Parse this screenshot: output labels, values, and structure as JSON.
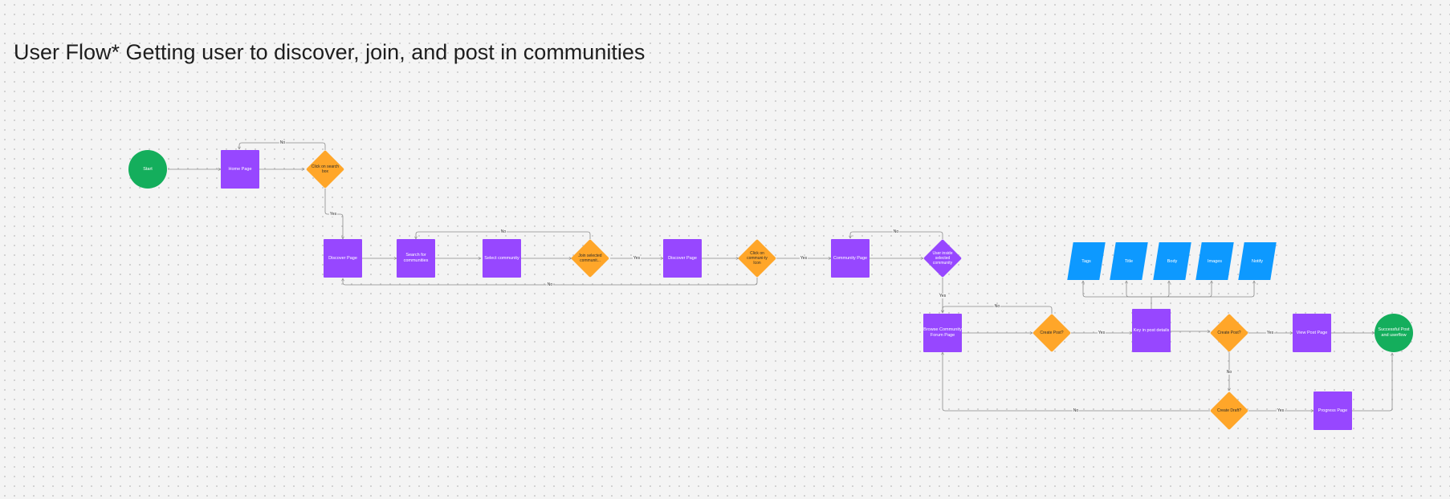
{
  "title": "User Flow* Getting user to discover, join, and post in communities",
  "colors": {
    "page_node": "#9747ff",
    "decision": "#ffa629",
    "terminal": "#14ae5c",
    "field": "#0d99ff",
    "connector": "#8a8a8a"
  },
  "nodes": {
    "start": "Start",
    "home_page": "Home Page",
    "click_search": "Click on search box",
    "discover_page_1": "Discover Page",
    "search_communities": "Search for communities",
    "select_community": "Select community",
    "join_community": "Join selected communit...",
    "discover_page_2": "Discover Page",
    "click_community_icon": "Click on communi-ty Icon",
    "community_page": "Community Page",
    "user_inside_community": "User inside selected community",
    "browse_forum": "Browse Community Forum Page",
    "create_post_q": "Create Post?",
    "key_in_post": "Key in post details",
    "create_post_q2": "Create Post?",
    "view_post": "View Post Page",
    "success": "Successful Post and userflow",
    "create_draft_q": "Create Draft?",
    "progress_page": "Progress Page",
    "field_tags": "Tags",
    "field_title": "Title",
    "field_body": "Body",
    "field_images": "Images",
    "field_notify": "Notify"
  },
  "labels": {
    "no_home": "No",
    "yes_search": "Yes",
    "no_join": "No",
    "yes_join": "Yes",
    "no_back": "No",
    "yes_icon": "Yes",
    "no_comm": "No",
    "yes_comm": "Yes",
    "no_create": "No",
    "yes_create": "Yes",
    "yes_create2": "Yes",
    "no_create2": "No",
    "no_draft": "No",
    "yes_draft": "Yes"
  }
}
